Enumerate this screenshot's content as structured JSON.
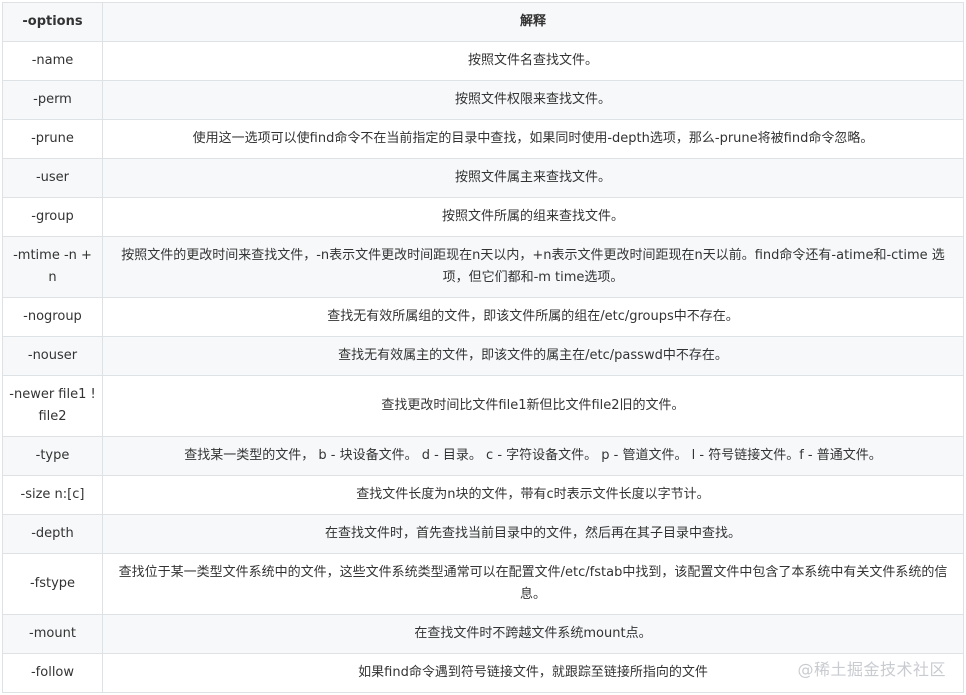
{
  "table": {
    "headers": [
      "-options",
      "解释"
    ],
    "rows": [
      {
        "option": "-name",
        "desc": "按照文件名查找文件。"
      },
      {
        "option": "-perm",
        "desc": "按照文件权限来查找文件。"
      },
      {
        "option": "-prune",
        "desc": "使用这一选项可以使find命令不在当前指定的目录中查找，如果同时使用-depth选项，那么-prune将被find命令忽略。"
      },
      {
        "option": "-user",
        "desc": "按照文件属主来查找文件。"
      },
      {
        "option": "-group",
        "desc": "按照文件所属的组来查找文件。"
      },
      {
        "option": "-mtime -n +n",
        "desc": "按照文件的更改时间来查找文件，-n表示文件更改时间距现在n天以内，+n表示文件更改时间距现在n天以前。find命令还有-atime和-ctime 选项，但它们都和-m time选项。"
      },
      {
        "option": "-nogroup",
        "desc": "查找无有效所属组的文件，即该文件所属的组在/etc/groups中不存在。"
      },
      {
        "option": "-nouser",
        "desc": "查找无有效属主的文件，即该文件的属主在/etc/passwd中不存在。"
      },
      {
        "option": "-newer file1 ! file2",
        "desc": "查找更改时间比文件file1新但比文件file2旧的文件。"
      },
      {
        "option": "-type",
        "desc": "查找某一类型的文件， b - 块设备文件。 d - 目录。 c - 字符设备文件。 p - 管道文件。 l - 符号链接文件。f - 普通文件。"
      },
      {
        "option": "-size n:[c]",
        "desc": "查找文件长度为n块的文件，带有c时表示文件长度以字节计。"
      },
      {
        "option": "-depth",
        "desc": "在查找文件时，首先查找当前目录中的文件，然后再在其子目录中查找。"
      },
      {
        "option": "-fstype",
        "desc": "查找位于某一类型文件系统中的文件，这些文件系统类型通常可以在配置文件/etc/fstab中找到，该配置文件中包含了本系统中有关文件系统的信息。"
      },
      {
        "option": "-mount",
        "desc": "在查找文件时不跨越文件系统mount点。"
      },
      {
        "option": "-follow",
        "desc": "如果find命令遇到符号链接文件，就跟踪至链接所指向的文件"
      }
    ]
  },
  "watermark": "@稀土掘金技术社区"
}
